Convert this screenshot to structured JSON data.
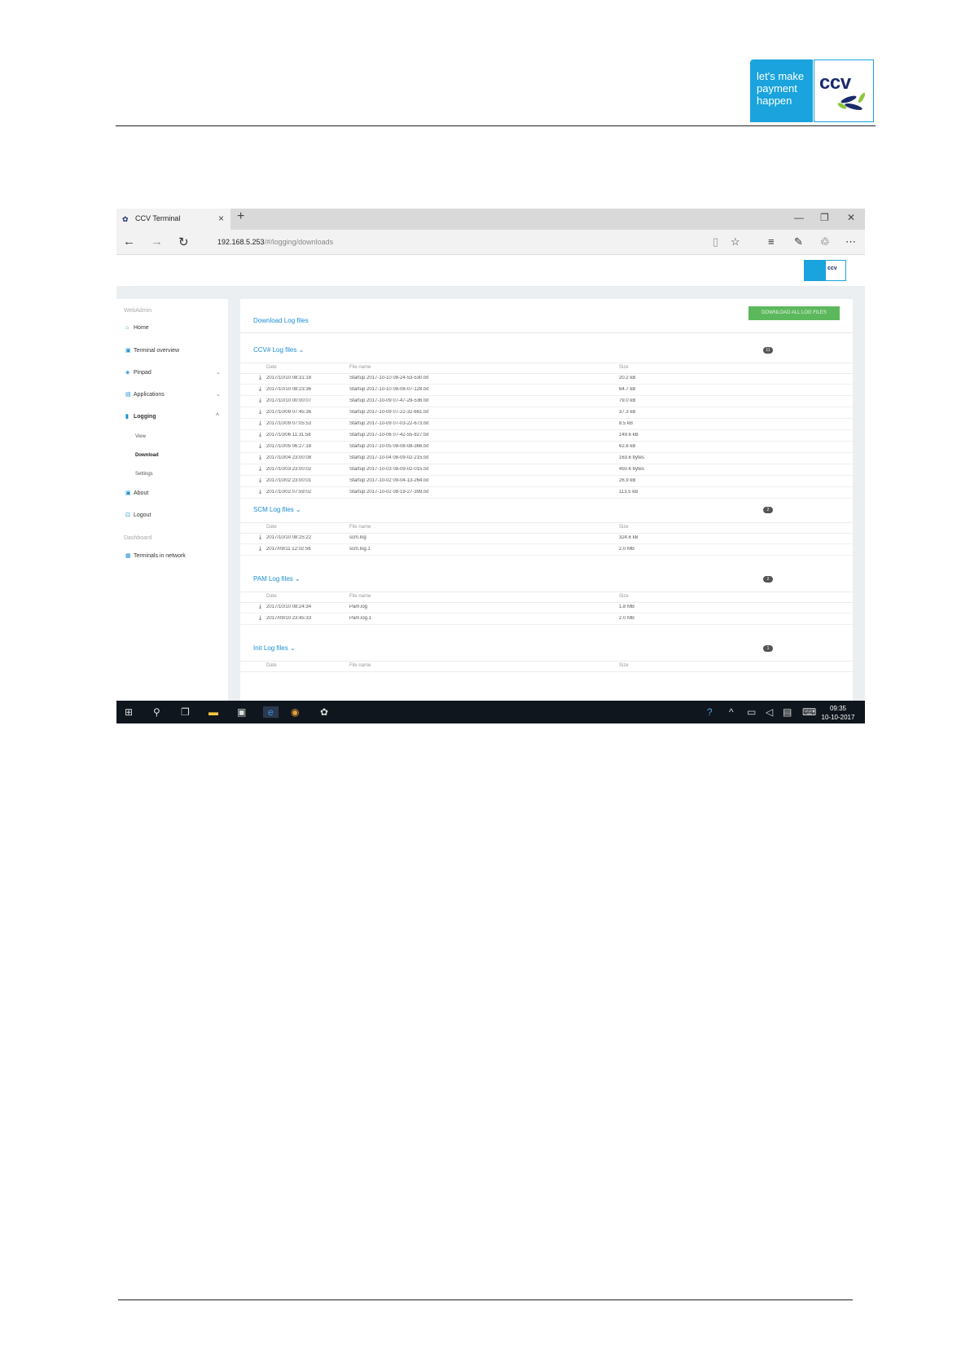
{
  "document": {
    "logo": {
      "slogan": [
        "let's make",
        "payment",
        "happen"
      ],
      "brand": "ccv"
    }
  },
  "browser": {
    "tab_title": "CCV Terminal",
    "new_tab": "+",
    "url_host": "192.168.5.253",
    "url_path": "/#/logging/downloads",
    "window_controls": [
      "—",
      "❐",
      "✕"
    ]
  },
  "site": {
    "logo_brand": "ccv"
  },
  "sidebar": {
    "section_webadmin": "WebAdmin",
    "items": [
      {
        "label": "Home",
        "icon": "home-icon"
      },
      {
        "label": "Terminal overview",
        "icon": "calendar-icon"
      },
      {
        "label": "Pinpad",
        "icon": "layers-icon"
      },
      {
        "label": "Applications",
        "icon": "card-icon"
      },
      {
        "label": "Logging",
        "icon": "file-icon"
      }
    ],
    "logging_sub": [
      "View",
      "Download",
      "Settings"
    ],
    "items2": [
      {
        "label": "About",
        "icon": "info-icon"
      },
      {
        "label": "Logout",
        "icon": "lock-icon"
      }
    ],
    "section_dashboard": "Dashboard",
    "dashboard_items": [
      {
        "label": "Terminals in network",
        "icon": "grid-icon"
      }
    ]
  },
  "panel": {
    "title": "Download Log files",
    "download_all": "DOWNLOAD ALL LOG FILES",
    "columns": {
      "date": "Date",
      "file": "File name",
      "size": "Size"
    },
    "sections": [
      {
        "title": "CCV# Log files",
        "count": "11",
        "rows": [
          {
            "date": "2017/10/10 08:31:18",
            "file": "Startup 2017-10-10 08-24-53-530.txt",
            "size": "20.2 kB"
          },
          {
            "date": "2017/10/10 08:23:36",
            "file": "Startup 2017-10-10 08-08-07-128.txt",
            "size": "64.7 kB"
          },
          {
            "date": "2017/10/10 00:00:07",
            "file": "Startup 2017-10-09 07-47-29-536.txt",
            "size": "79.0 kB"
          },
          {
            "date": "2017/10/09 07:45:36",
            "file": "Startup 2017-10-09 07-22-32-661.txt",
            "size": "37.3 kB"
          },
          {
            "date": "2017/10/09 07:05:53",
            "file": "Startup 2017-10-09 07-03-22-673.txt",
            "size": "8.5 kB"
          },
          {
            "date": "2017/10/06 11:31:58",
            "file": "Startup 2017-10-06 07-42-55-827.txt",
            "size": "149.6 kB"
          },
          {
            "date": "2017/10/05 06:27:18",
            "file": "Startup 2017-10-05 08-08-08-366.txt",
            "size": "62.6 kB"
          },
          {
            "date": "2017/10/04 23:00:08",
            "file": "Startup 2017-10-04 08-09-02-215.txt",
            "size": "163.6 bytes"
          },
          {
            "date": "2017/10/03 23:00:02",
            "file": "Startup 2017-10-03 08-09-02-015.txt",
            "size": "450.6 bytes"
          },
          {
            "date": "2017/10/02 23:00:01",
            "file": "Startup 2017-10-02 09-04-13-264.txt",
            "size": "26.9 kB"
          },
          {
            "date": "2017/10/02 07:59:02",
            "file": "Startup 2017-10-02 08-19-27-399.txt",
            "size": "113.5 kB"
          }
        ]
      },
      {
        "title": "SCM Log files",
        "count": "2",
        "rows": [
          {
            "date": "2017/10/10 08:25:22",
            "file": "scm.log",
            "size": "324.6 kB"
          },
          {
            "date": "2017/09/11 12:02:56",
            "file": "scm.log.1",
            "size": "2.0 MB"
          }
        ]
      },
      {
        "title": "PAM Log files",
        "count": "2",
        "rows": [
          {
            "date": "2017/10/10 08:24:34",
            "file": "Pam.log",
            "size": "1.8 MB"
          },
          {
            "date": "2017/09/10 23:45:33",
            "file": "Pam.log.1",
            "size": "2.0 MB"
          }
        ]
      },
      {
        "title": "Init Log files",
        "count": "1",
        "rows": []
      }
    ]
  },
  "taskbar": {
    "time": "09:35",
    "date": "10-10-2017"
  }
}
